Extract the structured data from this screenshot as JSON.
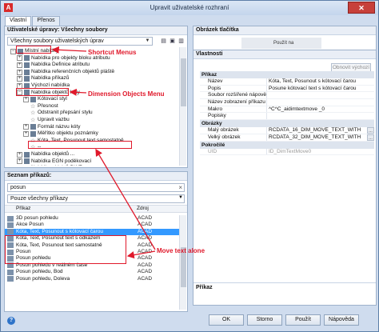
{
  "window": {
    "title": "Upravit uživatelské rozhraní",
    "close_symbol": "✕"
  },
  "tabs": [
    "Vlastní",
    "Přenos"
  ],
  "customizations": {
    "heading": "Uživatelské úpravy: Všechny soubory",
    "file_dropdown": "Všechny soubory uživatelských úprav",
    "tree": [
      {
        "label": "Místní nabídky",
        "indent": 1,
        "toggle": "−",
        "icon": "folder"
      },
      {
        "label": "Nabídka pro objekty bloku atributu",
        "indent": 2,
        "toggle": "+",
        "icon": "menu"
      },
      {
        "label": "Nabídka Definice atributu",
        "indent": 2,
        "toggle": "+",
        "icon": "menu"
      },
      {
        "label": "Nabídka referenčních objektů pláště",
        "indent": 2,
        "toggle": "+",
        "icon": "menu"
      },
      {
        "label": "Nabídka příkazů",
        "indent": 2,
        "toggle": "+",
        "icon": "menu"
      },
      {
        "label": "Výchozí nabídka",
        "indent": 2,
        "toggle": "+",
        "icon": "menu"
      },
      {
        "label": "Nabídka objektů kóty",
        "indent": 2,
        "toggle": "−",
        "icon": "menu"
      },
      {
        "label": "Kótovací styl",
        "indent": 3,
        "toggle": "+",
        "icon": "menu"
      },
      {
        "label": "Přesnost",
        "indent": 3,
        "toggle": "",
        "icon": "star"
      },
      {
        "label": "Odstranit přepsání stylu",
        "indent": 3,
        "toggle": "",
        "icon": "star"
      },
      {
        "label": "Upravit vazbu",
        "indent": 3,
        "toggle": "",
        "icon": "star"
      },
      {
        "label": "Formát názvu kóty",
        "indent": 3,
        "toggle": "+",
        "icon": "menu"
      },
      {
        "label": "Měřítko objektu poznámky",
        "indent": 3,
        "toggle": "+",
        "icon": "menu"
      },
      {
        "label": "Kóta, Text, Posunout text samostatně",
        "indent": 3,
        "toggle": "",
        "icon": "star"
      },
      {
        "label": "--",
        "indent": 3,
        "toggle": "",
        "icon": "star"
      },
      {
        "label": "Nabídka objektů ...",
        "indent": 2,
        "toggle": "+",
        "icon": "menu"
      },
      {
        "label": "Nabídka EGN poděkovací",
        "indent": 2,
        "toggle": "+",
        "icon": "menu"
      },
      {
        "label": "Nabídka objektů DWF",
        "indent": 2,
        "toggle": "+",
        "icon": "menu"
      }
    ]
  },
  "commands": {
    "heading": "Seznam příkazů:",
    "search_value": "posun",
    "clear_symbol": "×",
    "filter_value": "Pouze všechny příkazy",
    "col_command": "Příkaz",
    "col_source": "Zdroj",
    "rows": [
      {
        "name": "3D posun pohledu",
        "source": "ACAD"
      },
      {
        "name": "Akce Posun",
        "source": "ACAD"
      },
      {
        "name": "Kóta, Text, Posunout s kótovací čarou",
        "source": "ACAD",
        "selected": true
      },
      {
        "name": "Kóta, Text, Posunout text s odkazem",
        "source": "ACAD"
      },
      {
        "name": "Kóta, Text, Posunout text samostatně",
        "source": "ACAD"
      },
      {
        "name": "Posun",
        "source": "ACAD"
      },
      {
        "name": "Posun pohledu",
        "source": "ACAD"
      },
      {
        "name": "Posun pohledu v reálném čase",
        "source": "ACAD"
      },
      {
        "name": "Posun pohledu, Bod",
        "source": "ACAD"
      },
      {
        "name": "Posun pohledu, Doleva",
        "source": "ACAD"
      }
    ]
  },
  "button_image": {
    "heading": "Obrázek tlačítka",
    "preview_text": "Použít na",
    "revert_button": "Obnovit výchozí"
  },
  "properties": {
    "heading": "Vlastnosti",
    "categories": [
      {
        "name": "Příkaz",
        "rows": [
          {
            "name": "Název",
            "value": "Kóta, Text, Posunout s kótovací čarou"
          },
          {
            "name": "Popis",
            "value": "Posune kótovací text s kótovací čarou"
          },
          {
            "name": "Soubor rozšířené nápovědy",
            "value": ""
          },
          {
            "name": "Název zobrazení příkazu",
            "value": ""
          },
          {
            "name": "Makro",
            "value": "^C^C_aidimtextmove _0"
          },
          {
            "name": "Popisky",
            "value": ""
          }
        ]
      },
      {
        "name": "Obrázky",
        "rows": [
          {
            "name": "Malý obrázek",
            "value": "RCDATA_16_DIM_MOVE_TEXT_WITH"
          },
          {
            "name": "Velký obrázek",
            "value": "RCDATA_32_DIM_MOVE_TEXT_WITH"
          }
        ]
      },
      {
        "name": "Pokročilé",
        "rows": [
          {
            "name": "UID",
            "value": "ID_DimTextMove0",
            "disabled": true
          }
        ]
      }
    ],
    "help_heading": "Příkaz"
  },
  "footer": {
    "help_symbol": "?",
    "ok": "OK",
    "cancel": "Storno",
    "apply": "Použít",
    "help": "Nápověda"
  },
  "annotations": {
    "shortcut_menus": "Shortcut Menus",
    "dimension_menu": "Dimension Objects Menu",
    "move_text_alone": "Move text alone",
    "color": "#e0192b"
  }
}
